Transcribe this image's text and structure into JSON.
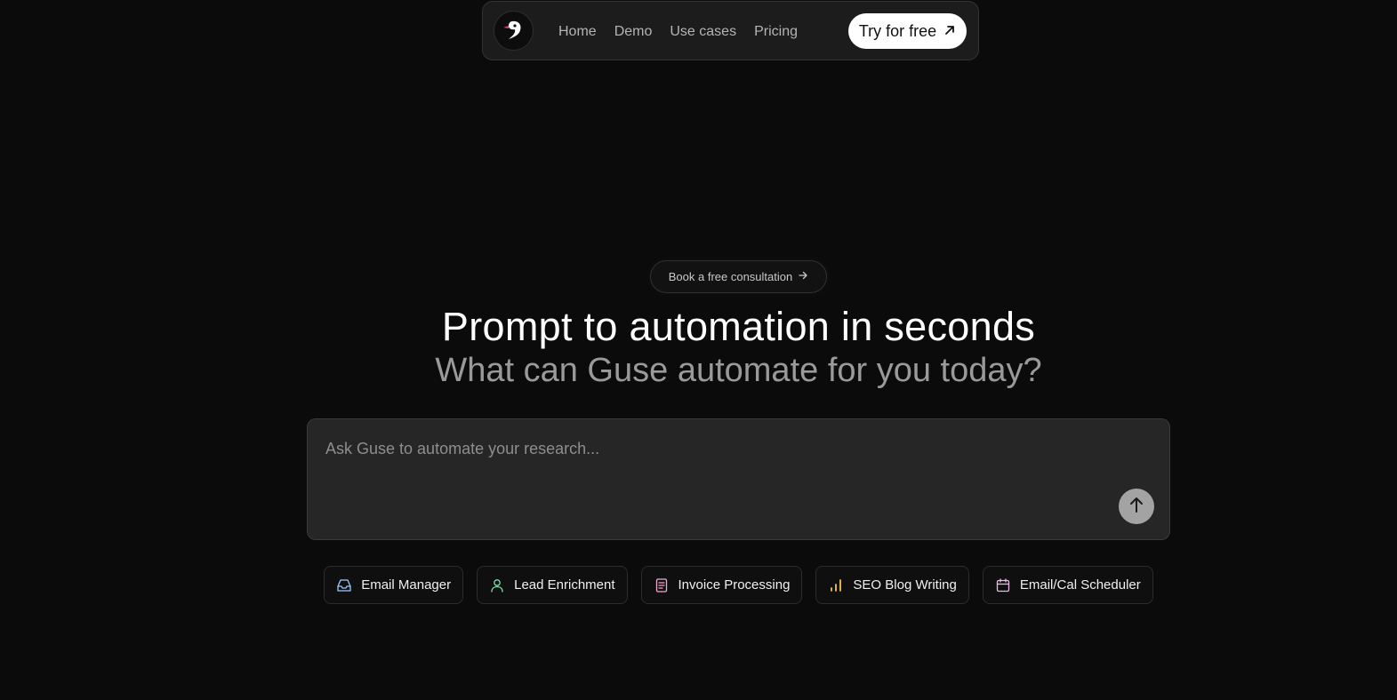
{
  "nav": {
    "logo_icon": "guse-bird-logo-icon",
    "links": [
      "Home",
      "Demo",
      "Use cases",
      "Pricing"
    ],
    "cta_label": "Try for free",
    "cta_icon": "arrow-up-right-icon"
  },
  "consult": {
    "label": "Book a free consultation",
    "icon": "arrow-right-icon"
  },
  "hero": {
    "title": "Prompt to automation in seconds",
    "subtitle": "What can Guse automate for you today?"
  },
  "prompt": {
    "placeholder": "Ask Guse to automate your research...",
    "value": "",
    "send_icon": "arrow-up-icon"
  },
  "chips": [
    {
      "label": "Email Manager",
      "icon": "inbox-icon",
      "color": "#9ec9ff"
    },
    {
      "label": "Lead Enrichment",
      "icon": "user-icon",
      "color": "#7fe0a8"
    },
    {
      "label": "Invoice Processing",
      "icon": "document-icon",
      "color": "#f3a6d0"
    },
    {
      "label": "SEO Blog Writing",
      "icon": "bar-chart-icon",
      "color": "#f5c542"
    },
    {
      "label": "Email/Cal Scheduler",
      "icon": "calendar-icon",
      "color": "#f0b8e8"
    }
  ]
}
